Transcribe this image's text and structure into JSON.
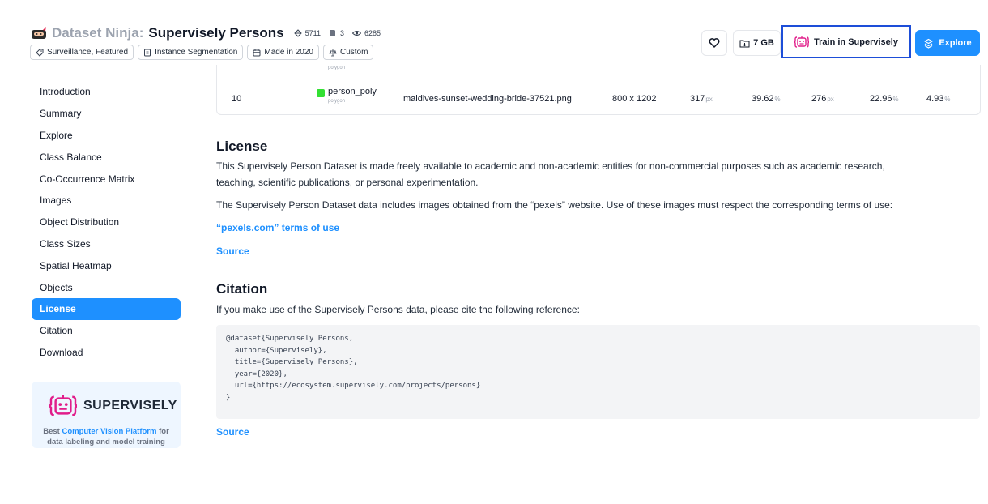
{
  "header": {
    "brand": "Dataset Ninja",
    "brand_colon": ":",
    "dataset_name": "Supervisely Persons",
    "stats": {
      "images": "5711",
      "classes": "3",
      "views": "6285"
    },
    "tags": [
      {
        "icon": "tag-icon",
        "label": "Surveillance, Featured"
      },
      {
        "icon": "segmentation-icon",
        "label": "Instance Segmentation"
      },
      {
        "icon": "calendar-icon",
        "label": "Made in 2020"
      },
      {
        "icon": "custom-license-icon",
        "label": "Custom"
      }
    ],
    "size_label": "7 GB",
    "train_label": "Train in Supervisely",
    "explore_label": "Explore"
  },
  "sidebar": {
    "items": [
      {
        "label": "Introduction",
        "active": false
      },
      {
        "label": "Summary",
        "active": false
      },
      {
        "label": "Explore",
        "active": false
      },
      {
        "label": "Class Balance",
        "active": false
      },
      {
        "label": "Co-Occurrence Matrix",
        "active": false
      },
      {
        "label": "Images",
        "active": false
      },
      {
        "label": "Object Distribution",
        "active": false
      },
      {
        "label": "Class Sizes",
        "active": false
      },
      {
        "label": "Spatial Heatmap",
        "active": false
      },
      {
        "label": "Objects",
        "active": false
      },
      {
        "label": "License",
        "active": true
      },
      {
        "label": "Citation",
        "active": false
      },
      {
        "label": "Download",
        "active": false
      }
    ],
    "promo": {
      "brand": "SUPERVISELY",
      "text_prefix": "Best ",
      "text_link": "Computer Vision Platform",
      "text_suffix": " for",
      "text_line2": "data labeling and model training"
    }
  },
  "table": {
    "partial_type_label": "polygon",
    "row": {
      "index": "10",
      "class_name": "person_poly",
      "class_type": "polygon",
      "class_color": "#33e033",
      "file_name": "maldives-sunset-wedding-bride-37521.png",
      "image_size": "800 x 1202",
      "height_px": "317",
      "height_unit": "px",
      "height_pct": "39.62",
      "pct_unit": "%",
      "width_px": "276",
      "width_unit": "px",
      "width_pct": "22.96",
      "area_pct": "4.93"
    }
  },
  "license": {
    "heading": "License",
    "para1_line1": "This Supervisely Person Dataset is made freely available to academic and non-academic entities for non-commercial purposes such as academic research,",
    "para1_line2": "teaching, scientific publications, or personal experimentation.",
    "para2": "The Supervisely Person Dataset data includes images obtained from the “pexels” website. Use of these images must respect the corresponding terms of use:",
    "terms_link": "“pexels.com” terms of use",
    "source_link": "Source"
  },
  "citation": {
    "heading": "Citation",
    "intro": "If you make use of the Supervisely Persons data, please cite the following reference:",
    "code_lines": [
      "@dataset{Supervisely Persons,",
      "  author={Supervisely},",
      "  title={Supervisely Persons},",
      "  year={2020},",
      "  url={https://ecosystem.supervisely.com/projects/persons}",
      "}"
    ],
    "source_link": "Source"
  },
  "colors": {
    "accent": "#1e90ff",
    "highlight_border": "#1d4ed8",
    "class_swatch": "#33e033"
  }
}
